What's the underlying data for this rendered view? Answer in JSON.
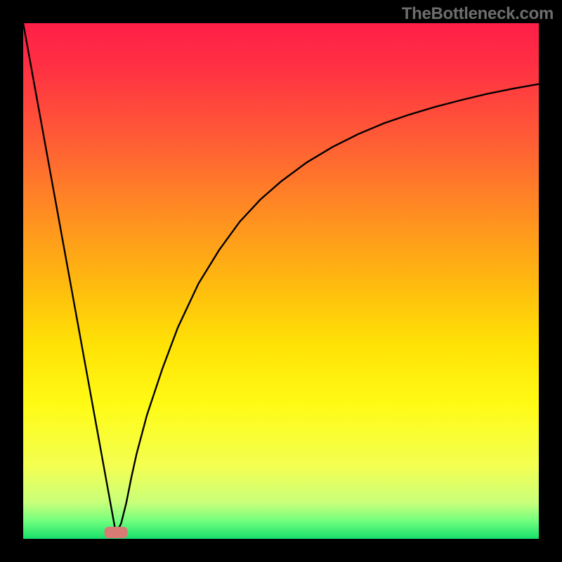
{
  "watermark": "TheBottleneck.com",
  "chart_data": {
    "type": "line",
    "title": "",
    "xlabel": "",
    "ylabel": "",
    "xlim": [
      0,
      100
    ],
    "ylim": [
      0,
      100
    ],
    "notes": "Black curve has a sharp V-shaped dip at x≈18 where y→0, a linear descent on the left branch from (0,100) and an asymptotic rise on the right branch approaching y≈89 at x=100. Background is a vertical gradient: green (bottom ~4%) → yellow (mid) → orange → red (top). A small rounded salmon rectangle marks the minimum.",
    "series": [
      {
        "name": "curve",
        "x": [
          0,
          3,
          6,
          9,
          12,
          15,
          17,
          18,
          19,
          20,
          21,
          22,
          24,
          27,
          30,
          34,
          38,
          42,
          46,
          50,
          55,
          60,
          65,
          70,
          75,
          80,
          85,
          90,
          95,
          100
        ],
        "y": [
          100,
          83.5,
          67,
          50.5,
          34,
          17.5,
          6.5,
          1,
          3,
          7,
          12,
          16.5,
          24,
          33,
          41,
          49.5,
          56,
          61.5,
          65.8,
          69.3,
          73,
          76,
          78.5,
          80.6,
          82.3,
          83.8,
          85.1,
          86.3,
          87.3,
          88.2
        ]
      }
    ],
    "marker": {
      "x": 18,
      "width": 4.5,
      "height": 2.2
    },
    "gradient_stops": [
      {
        "offset": 0.0,
        "color": "#ff1f48"
      },
      {
        "offset": 0.08,
        "color": "#ff2f43"
      },
      {
        "offset": 0.22,
        "color": "#ff5a36"
      },
      {
        "offset": 0.36,
        "color": "#ff8a23"
      },
      {
        "offset": 0.5,
        "color": "#ffb80f"
      },
      {
        "offset": 0.62,
        "color": "#ffe106"
      },
      {
        "offset": 0.74,
        "color": "#fffb15"
      },
      {
        "offset": 0.86,
        "color": "#f3ff52"
      },
      {
        "offset": 0.93,
        "color": "#c8ff7a"
      },
      {
        "offset": 0.965,
        "color": "#72ff7e"
      },
      {
        "offset": 1.0,
        "color": "#17e06b"
      }
    ],
    "marker_color": "#d77b74",
    "curve_color": "#000000"
  }
}
